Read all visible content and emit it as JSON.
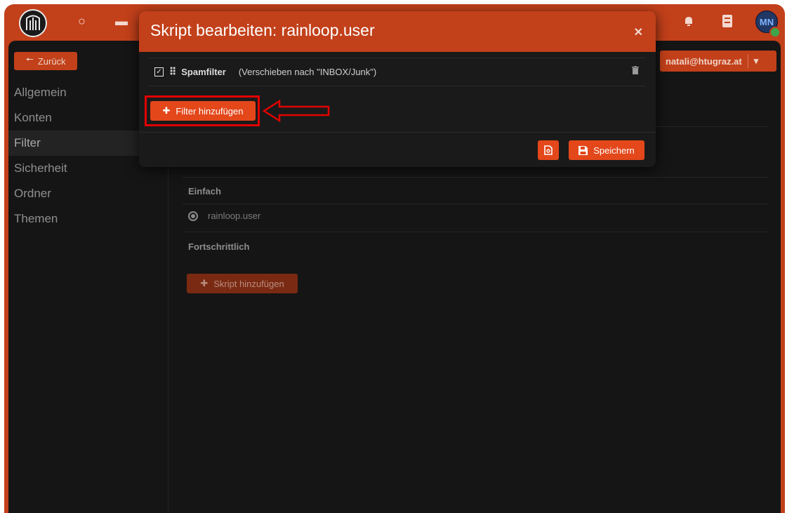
{
  "app": {
    "avatar_initials": "MN",
    "colors": {
      "brand": "#c2401a",
      "button": "#e3471a",
      "background": "#151515",
      "highlight": "#e20000"
    },
    "top_icons": [
      "circle-icon",
      "folder-icon",
      "search-icon",
      "bell-icon",
      "contacts-icon"
    ]
  },
  "sidebar": {
    "back_label": "Zurück",
    "items": [
      {
        "label": "Allgemein",
        "active": false
      },
      {
        "label": "Konten",
        "active": false
      },
      {
        "label": "Filter",
        "active": true
      },
      {
        "label": "Sicherheit",
        "active": false
      },
      {
        "label": "Ordner",
        "active": false
      },
      {
        "label": "Themen",
        "active": false
      }
    ]
  },
  "header": {
    "user_email": "natali@htugraz.at"
  },
  "main": {
    "section_simple": "Einfach",
    "script_name": "rainloop.user",
    "section_advanced": "Fortschrittlich",
    "add_script_label": "Skript hinzufügen"
  },
  "modal": {
    "title": "Skript bearbeiten: rainloop.user",
    "filter": {
      "name": "Spamfilter",
      "description": "(Verschieben nach \"INBOX/Junk\")",
      "checked": true
    },
    "add_filter_label": "Filter hinzufügen",
    "save_label": "Speichern"
  }
}
